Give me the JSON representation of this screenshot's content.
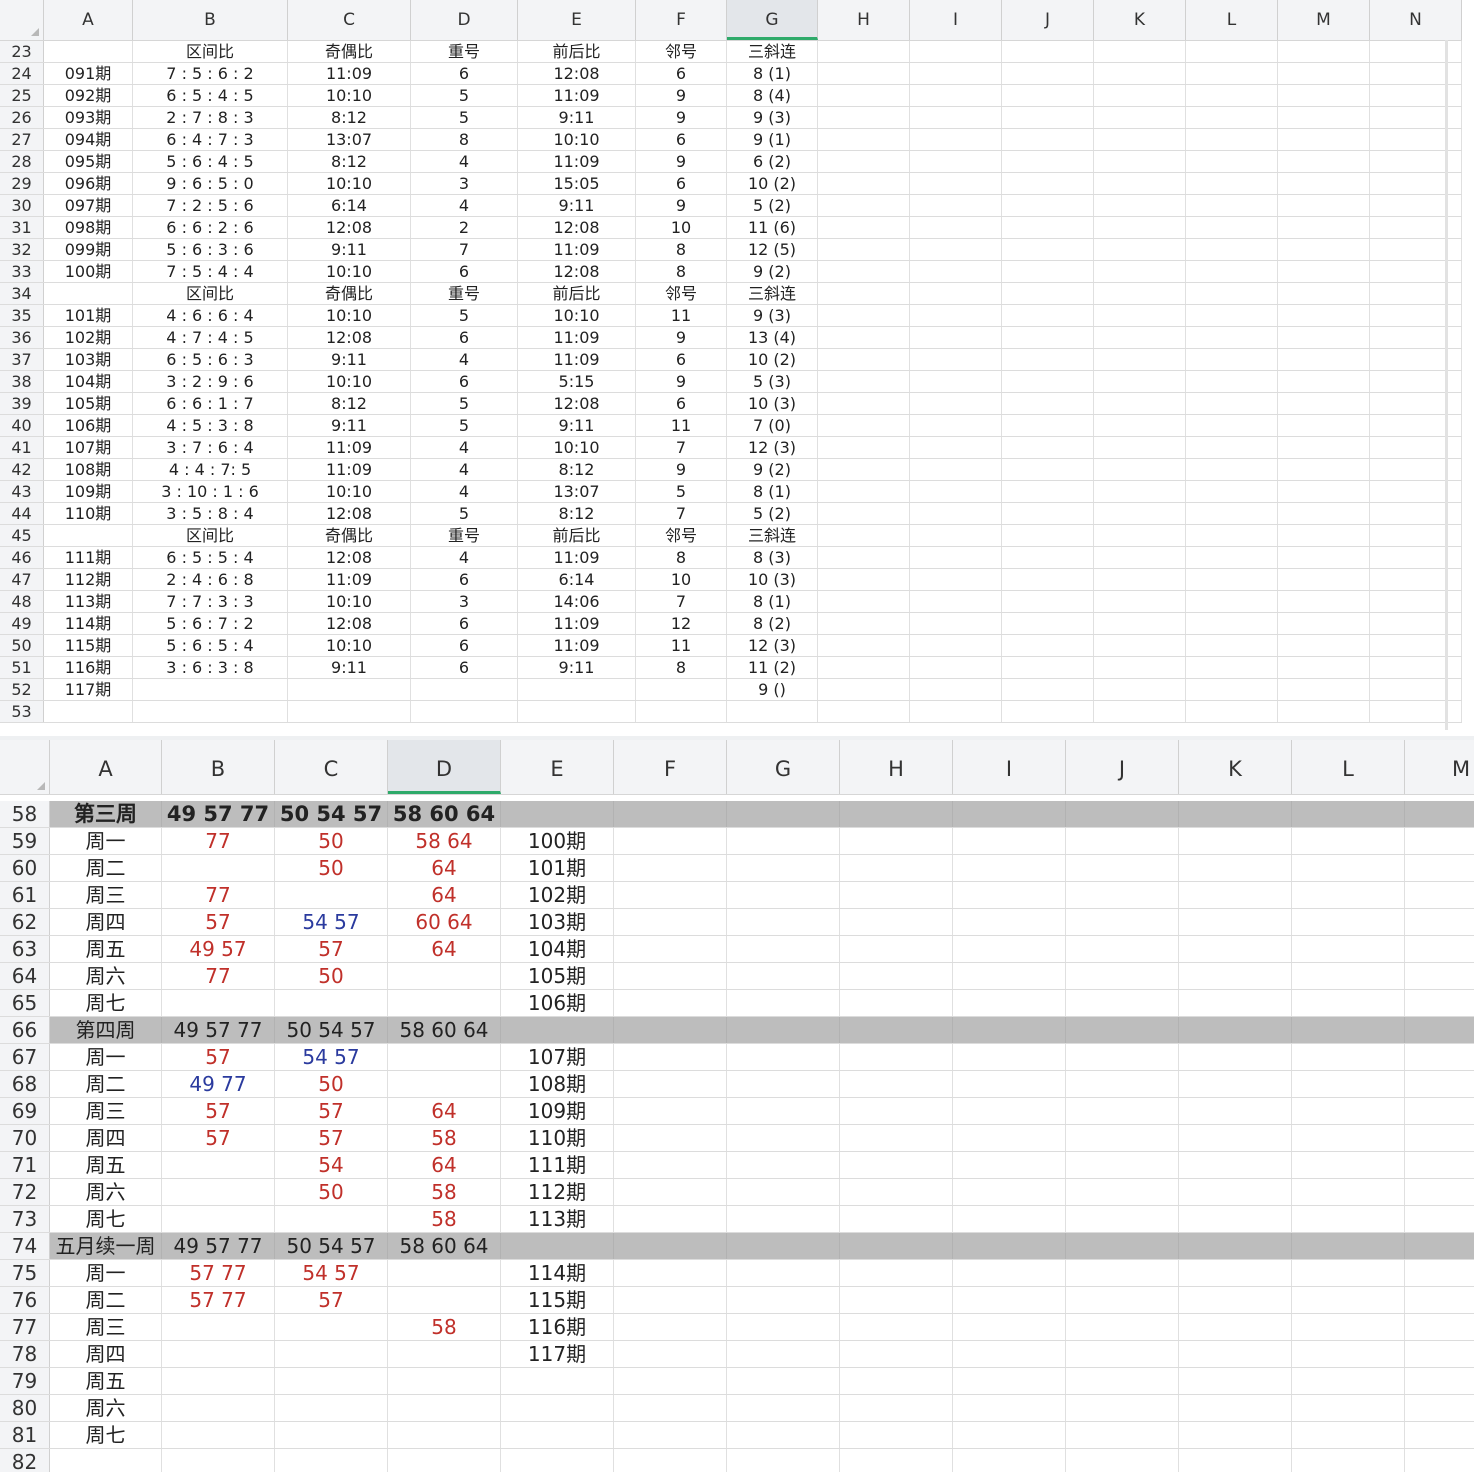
{
  "sheet1": {
    "columns": [
      "A",
      "B",
      "C",
      "D",
      "E",
      "F",
      "G",
      "H",
      "I",
      "J",
      "K",
      "L",
      "M",
      "N"
    ],
    "selected_column": "G",
    "rows": [
      {
        "n": "23",
        "cells": [
          "",
          "区间比",
          "奇偶比",
          "重号",
          "前后比",
          "邻号",
          "三斜连"
        ]
      },
      {
        "n": "24",
        "cells": [
          "091期",
          "7 :  5 :  6 :  2",
          "11:09",
          "6",
          "12:08",
          "6",
          "8 (1)"
        ]
      },
      {
        "n": "25",
        "cells": [
          "092期",
          "6 :  5 :  4 :  5",
          "10:10",
          "5",
          "11:09",
          "9",
          "8 (4)"
        ]
      },
      {
        "n": "26",
        "cells": [
          "093期",
          "2 :  7 :  8 :  3",
          "8:12",
          "5",
          "9:11",
          "9",
          "9 (3)"
        ]
      },
      {
        "n": "27",
        "cells": [
          "094期",
          "6 :  4 :  7 :  3",
          "13:07",
          "8",
          "10:10",
          "6",
          "9 (1)"
        ]
      },
      {
        "n": "28",
        "cells": [
          "095期",
          "5 : 6 :  4 :  5",
          "8:12",
          "4",
          "11:09",
          "9",
          "6 (2)"
        ]
      },
      {
        "n": "29",
        "cells": [
          "096期",
          "9 :  6 : 5 :  0",
          "10:10",
          "3",
          "15:05",
          "6",
          "10 (2)"
        ]
      },
      {
        "n": "30",
        "cells": [
          "097期",
          "7 :  2 :  5 :  6",
          "6:14",
          "4",
          "9:11",
          "9",
          "5 (2)"
        ]
      },
      {
        "n": "31",
        "cells": [
          "098期",
          "6 :  6 :  2 :  6",
          "12:08",
          "2",
          "12:08",
          "10",
          "11 (6)"
        ]
      },
      {
        "n": "32",
        "cells": [
          "099期",
          "5 :  6 :  3 :  6",
          "9:11",
          "7",
          "11:09",
          "8",
          "12 (5)"
        ]
      },
      {
        "n": "33",
        "cells": [
          "100期",
          "7 :  5 :  4 :  4",
          "10:10",
          "6",
          "12:08",
          "8",
          "9 (2)"
        ]
      },
      {
        "n": "34",
        "cells": [
          "",
          "区间比",
          "奇偶比",
          "重号",
          "前后比",
          "邻号",
          "三斜连"
        ]
      },
      {
        "n": "35",
        "cells": [
          "101期",
          "4 :  6 :  6 :  4",
          "10:10",
          "5",
          "10:10",
          "11",
          "9 (3)"
        ]
      },
      {
        "n": "36",
        "cells": [
          "102期",
          "4 :  7 :  4 :  5",
          "12:08",
          "6",
          "11:09",
          "9",
          "13 (4)"
        ]
      },
      {
        "n": "37",
        "cells": [
          "103期",
          "6 :  5 :  6 :  3",
          "9:11",
          "4",
          "11:09",
          "6",
          "10 (2)"
        ]
      },
      {
        "n": "38",
        "cells": [
          "104期",
          "3 :  2 :  9 :  6",
          "10:10",
          "6",
          "5:15",
          "9",
          "5 (3)"
        ]
      },
      {
        "n": "39",
        "cells": [
          "105期",
          "6 :  6 :  1 :  7",
          "8:12",
          "5",
          "12:08",
          "6",
          "10 (3)"
        ]
      },
      {
        "n": "40",
        "cells": [
          "106期",
          "4 : 5 :  3 :  8",
          "9:11",
          "5",
          "9:11",
          "11",
          "7 (0)"
        ]
      },
      {
        "n": "41",
        "cells": [
          "107期",
          "3 :  7 :  6 :  4",
          "11:09",
          "4",
          "10:10",
          "7",
          "12 (3)"
        ]
      },
      {
        "n": "42",
        "cells": [
          "108期",
          "4 : 4 :  7:  5",
          "11:09",
          "4",
          "8:12",
          "9",
          "9 (2)"
        ]
      },
      {
        "n": "43",
        "cells": [
          "109期",
          "3 :  10 :  1 :  6",
          "10:10",
          "4",
          "13:07",
          "5",
          "8 (1)"
        ]
      },
      {
        "n": "44",
        "cells": [
          "110期",
          "3 :  5 :  8 :  4",
          "12:08",
          "5",
          "8:12",
          "7",
          "5 (2)"
        ]
      },
      {
        "n": "45",
        "cells": [
          "",
          "区间比",
          "奇偶比",
          "重号",
          "前后比",
          "邻号",
          "三斜连"
        ]
      },
      {
        "n": "46",
        "cells": [
          "111期",
          "6 :  5 :  5 :  4",
          "12:08",
          "4",
          "11:09",
          "8",
          "8 (3)"
        ]
      },
      {
        "n": "47",
        "cells": [
          "112期",
          "2 :  4 :  6 :  8",
          "11:09",
          "6",
          "6:14",
          "10",
          "10 (3)"
        ]
      },
      {
        "n": "48",
        "cells": [
          "113期",
          "7 :  7 :  3 :  3",
          "10:10",
          "3",
          "14:06",
          "7",
          "8 (1)"
        ]
      },
      {
        "n": "49",
        "cells": [
          "114期",
          "5 :  6 :  7 :  2",
          "12:08",
          "6",
          "11:09",
          "12",
          "8 (2)"
        ]
      },
      {
        "n": "50",
        "cells": [
          "115期",
          "5 : 6 : 5 :  4",
          "10:10",
          "6",
          "11:09",
          "11",
          "12 (3)"
        ]
      },
      {
        "n": "51",
        "cells": [
          "116期",
          "3 :  6 : 3 :  8",
          "9:11",
          "6",
          "9:11",
          "8",
          "11 (2)"
        ]
      },
      {
        "n": "52",
        "cells": [
          "117期",
          "",
          "",
          "",
          "",
          "",
          "9 ()"
        ]
      },
      {
        "n": "53",
        "cells": [
          "",
          "",
          "",
          "",
          "",
          "",
          ""
        ]
      }
    ]
  },
  "sheet2": {
    "columns": [
      "A",
      "B",
      "C",
      "D",
      "E",
      "F",
      "G",
      "H",
      "I",
      "J",
      "K",
      "L",
      "M"
    ],
    "selected_column": "D",
    "colors": {
      "red": "#c0302a",
      "blue": "#2a3a9e",
      "week_band": "#bdbdbd"
    },
    "rows": [
      {
        "n": "58",
        "week": true,
        "bold": true,
        "cells": [
          {
            "t": "第三周"
          },
          {
            "t": "49 57 77"
          },
          {
            "t": "50 54 57"
          },
          {
            "t": "58 60 64"
          },
          {
            "t": ""
          }
        ]
      },
      {
        "n": "59",
        "cells": [
          {
            "t": "周一"
          },
          {
            "t": "77",
            "c": "red"
          },
          {
            "t": "50",
            "c": "red"
          },
          {
            "t": "58 64",
            "c": "red"
          },
          {
            "t": "100期"
          }
        ]
      },
      {
        "n": "60",
        "cells": [
          {
            "t": "周二"
          },
          {
            "t": ""
          },
          {
            "t": "50",
            "c": "red"
          },
          {
            "t": "64",
            "c": "red"
          },
          {
            "t": "101期"
          }
        ]
      },
      {
        "n": "61",
        "cells": [
          {
            "t": "周三"
          },
          {
            "t": "77",
            "c": "red"
          },
          {
            "t": ""
          },
          {
            "t": "64",
            "c": "red"
          },
          {
            "t": "102期"
          }
        ]
      },
      {
        "n": "62",
        "cells": [
          {
            "t": "周四"
          },
          {
            "t": "57",
            "c": "red"
          },
          {
            "t": "54 57",
            "c": "blue"
          },
          {
            "t": "60 64",
            "c": "red"
          },
          {
            "t": "103期"
          }
        ]
      },
      {
        "n": "63",
        "cells": [
          {
            "t": "周五"
          },
          {
            "t": "49 57",
            "c": "red"
          },
          {
            "t": "57",
            "c": "red"
          },
          {
            "t": "64",
            "c": "red"
          },
          {
            "t": "104期"
          }
        ]
      },
      {
        "n": "64",
        "cells": [
          {
            "t": "周六"
          },
          {
            "t": "77",
            "c": "red"
          },
          {
            "t": "50",
            "c": "red"
          },
          {
            "t": ""
          },
          {
            "t": "105期"
          }
        ]
      },
      {
        "n": "65",
        "cells": [
          {
            "t": "周七"
          },
          {
            "t": ""
          },
          {
            "t": ""
          },
          {
            "t": ""
          },
          {
            "t": "106期"
          }
        ]
      },
      {
        "n": "66",
        "week": true,
        "cells": [
          {
            "t": "第四周"
          },
          {
            "t": "49 57 77"
          },
          {
            "t": "50 54 57"
          },
          {
            "t": "58 60 64"
          },
          {
            "t": ""
          }
        ]
      },
      {
        "n": "67",
        "cells": [
          {
            "t": "周一"
          },
          {
            "t": "57",
            "c": "red"
          },
          {
            "t": "54 57",
            "c": "blue"
          },
          {
            "t": ""
          },
          {
            "t": "107期"
          }
        ]
      },
      {
        "n": "68",
        "cells": [
          {
            "t": "周二"
          },
          {
            "t": "49 77",
            "c": "blue"
          },
          {
            "t": "50",
            "c": "red"
          },
          {
            "t": ""
          },
          {
            "t": "108期"
          }
        ]
      },
      {
        "n": "69",
        "cells": [
          {
            "t": "周三"
          },
          {
            "t": "57",
            "c": "red"
          },
          {
            "t": "57",
            "c": "red"
          },
          {
            "t": "64",
            "c": "red"
          },
          {
            "t": "109期"
          }
        ]
      },
      {
        "n": "70",
        "cells": [
          {
            "t": "周四"
          },
          {
            "t": "57",
            "c": "red"
          },
          {
            "t": "57",
            "c": "red"
          },
          {
            "t": "58",
            "c": "red"
          },
          {
            "t": "110期"
          }
        ]
      },
      {
        "n": "71",
        "cells": [
          {
            "t": "周五"
          },
          {
            "t": ""
          },
          {
            "t": "54",
            "c": "red"
          },
          {
            "t": "64",
            "c": "red"
          },
          {
            "t": "111期"
          }
        ]
      },
      {
        "n": "72",
        "cells": [
          {
            "t": "周六"
          },
          {
            "t": ""
          },
          {
            "t": "50",
            "c": "red"
          },
          {
            "t": "58",
            "c": "red"
          },
          {
            "t": "112期"
          }
        ]
      },
      {
        "n": "73",
        "cells": [
          {
            "t": "周七"
          },
          {
            "t": ""
          },
          {
            "t": ""
          },
          {
            "t": "58",
            "c": "red"
          },
          {
            "t": "113期"
          }
        ]
      },
      {
        "n": "74",
        "week": true,
        "cells": [
          {
            "t": "五月续一周"
          },
          {
            "t": "49 57 77"
          },
          {
            "t": "50 54 57"
          },
          {
            "t": "58 60 64"
          },
          {
            "t": ""
          }
        ]
      },
      {
        "n": "75",
        "cells": [
          {
            "t": "周一"
          },
          {
            "t": "57 77",
            "c": "red"
          },
          {
            "t": "54 57",
            "c": "red"
          },
          {
            "t": ""
          },
          {
            "t": "114期"
          }
        ]
      },
      {
        "n": "76",
        "cells": [
          {
            "t": "周二"
          },
          {
            "t": "57 77",
            "c": "red"
          },
          {
            "t": "57",
            "c": "red"
          },
          {
            "t": ""
          },
          {
            "t": "115期"
          }
        ]
      },
      {
        "n": "77",
        "cells": [
          {
            "t": "周三"
          },
          {
            "t": ""
          },
          {
            "t": ""
          },
          {
            "t": "58",
            "c": "red"
          },
          {
            "t": "116期"
          }
        ]
      },
      {
        "n": "78",
        "cells": [
          {
            "t": "周四"
          },
          {
            "t": ""
          },
          {
            "t": ""
          },
          {
            "t": ""
          },
          {
            "t": "117期"
          }
        ]
      },
      {
        "n": "79",
        "cells": [
          {
            "t": "周五"
          },
          {
            "t": ""
          },
          {
            "t": ""
          },
          {
            "t": ""
          },
          {
            "t": ""
          }
        ]
      },
      {
        "n": "80",
        "cells": [
          {
            "t": "周六"
          },
          {
            "t": ""
          },
          {
            "t": ""
          },
          {
            "t": ""
          },
          {
            "t": ""
          }
        ]
      },
      {
        "n": "81",
        "cells": [
          {
            "t": "周七"
          },
          {
            "t": ""
          },
          {
            "t": ""
          },
          {
            "t": ""
          },
          {
            "t": ""
          }
        ]
      },
      {
        "n": "82",
        "cells": [
          {
            "t": ""
          },
          {
            "t": ""
          },
          {
            "t": ""
          },
          {
            "t": ""
          },
          {
            "t": ""
          }
        ]
      }
    ]
  }
}
